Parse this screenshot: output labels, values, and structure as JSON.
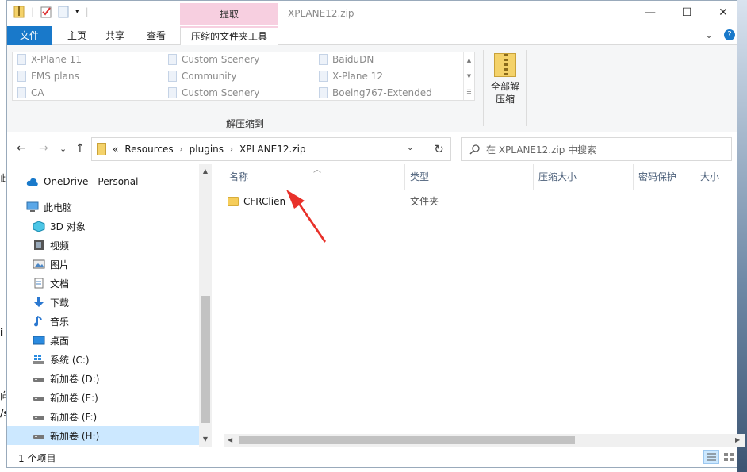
{
  "side_text": [
    "此",
    "i",
    "向",
    "/s"
  ],
  "titlebar": {
    "context_tab_title": "提取",
    "title": "XPLANE12.zip",
    "minimize": "—",
    "maximize": "☐",
    "close": "✕"
  },
  "ribbon_tabs": {
    "file": "文件",
    "home": "主页",
    "share": "共享",
    "view": "查看",
    "compressed_tools": "压缩的文件夹工具",
    "collapse": "⌄",
    "help": "?"
  },
  "gallery": {
    "col1": [
      "X-Plane 11",
      "FMS plans",
      "CA"
    ],
    "col2": [
      "Custom Scenery",
      "Community",
      "Custom Scenery"
    ],
    "col3": [
      "BaiduDN",
      "X-Plane 12",
      "Boeing767-Extended"
    ],
    "group_label": "解压缩到"
  },
  "extract_all": {
    "line1": "全部解",
    "line2": "压缩"
  },
  "nav": {
    "back": "←",
    "forward": "→",
    "recent": "⌄",
    "up": "↑",
    "address_overflow": "«",
    "address_parts": [
      "Resources",
      "plugins",
      "XPLANE12.zip"
    ],
    "refresh": "↻",
    "search_placeholder": "在 XPLANE12.zip 中搜索"
  },
  "navpane": {
    "onedrive": "OneDrive - Personal",
    "this_pc": "此电脑",
    "items": [
      "3D 对象",
      "视频",
      "图片",
      "文档",
      "下载",
      "音乐",
      "桌面",
      "系统 (C:)",
      "新加卷 (D:)",
      "新加卷 (E:)",
      "新加卷 (F:)",
      "新加卷 (H:)"
    ]
  },
  "columns": [
    "名称",
    "类型",
    "压缩大小",
    "密码保护",
    "大小"
  ],
  "files": [
    {
      "name": "CFRClien",
      "type": "文件夹"
    }
  ],
  "status": {
    "count": "1 个项目"
  },
  "colors": {
    "file_tab": "#1979ca",
    "context_tab": "#f7cfe0",
    "selection": "#cce8ff",
    "annotation_arrow": "#e8312a"
  }
}
